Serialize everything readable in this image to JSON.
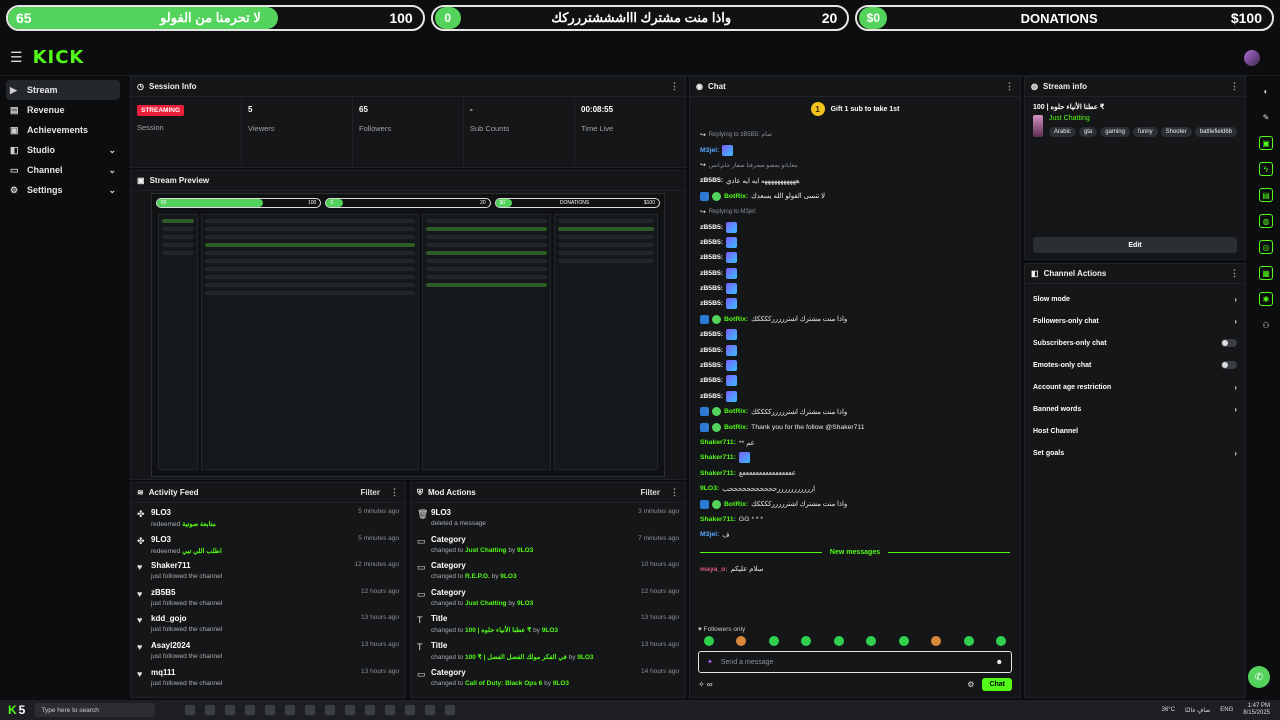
{
  "goals": [
    {
      "left": "65",
      "mid": "لا تحرمنا من الفولو",
      "right": "100",
      "progress": 0.65
    },
    {
      "badge": "0",
      "mid": "واذا منت مشترك اااشششتررركك",
      "right": "20",
      "progress": 0.0
    },
    {
      "badge": "$0",
      "mid": "DONATIONS",
      "right": "$100",
      "progress": 0.0
    }
  ],
  "browser": {
    "url": "dashboard.kick.com/stream"
  },
  "header": {
    "logo": "KICK"
  },
  "nav": [
    {
      "label": "Stream",
      "icon": "video-icon",
      "active": true
    },
    {
      "label": "Revenue",
      "icon": "dollar-icon",
      "active": false
    },
    {
      "label": "Achievements",
      "icon": "trophy-icon",
      "active": false
    },
    {
      "label": "Studio",
      "icon": "studio-icon",
      "active": false,
      "expandable": true
    },
    {
      "label": "Channel",
      "icon": "channel-icon",
      "active": false,
      "expandable": true
    },
    {
      "label": "Settings",
      "icon": "gear-icon",
      "active": false,
      "expandable": true
    }
  ],
  "session": {
    "title": "Session Info",
    "status": "STREAMING",
    "status_label": "Session",
    "viewers": "5",
    "viewers_label": "Viewers",
    "followers": "65",
    "followers_label": "Followers",
    "subs": "-",
    "subs_label": "Sub Counts",
    "time": "00:08:55",
    "time_label": "Time Live"
  },
  "preview": {
    "title": "Stream Preview",
    "goals": [
      "65",
      "100",
      "0",
      "20",
      "$0",
      "DONATIONS",
      "$100"
    ]
  },
  "activity": {
    "title": "Activity Feed",
    "filter": "Filter",
    "items": [
      {
        "name": "9LO3",
        "sub": "redeemed",
        "hl": "متابعة صوتية",
        "time": "5 minutes ago",
        "icon": "gift-icon"
      },
      {
        "name": "9LO3",
        "sub": "redeemed",
        "hl": "اطلب اللي تبي",
        "time": "5 minutes ago",
        "icon": "gift-icon"
      },
      {
        "name": "Shaker711",
        "sub": "just followed the channel",
        "hl": "",
        "time": "12 minutes ago",
        "icon": "heart-icon"
      },
      {
        "name": "zB5B5",
        "sub": "just followed the channel",
        "hl": "",
        "time": "12 hours ago",
        "icon": "heart-icon"
      },
      {
        "name": "kdd_gojo",
        "sub": "just followed the channel",
        "hl": "",
        "time": "13 hours ago",
        "icon": "heart-icon"
      },
      {
        "name": "Asayl2024",
        "sub": "just followed the channel",
        "hl": "",
        "time": "13 hours ago",
        "icon": "heart-icon"
      },
      {
        "name": "mq111",
        "sub": "just followed the channel",
        "hl": "",
        "time": "13 hours ago",
        "icon": "heart-icon"
      }
    ]
  },
  "mod": {
    "title": "Mod Actions",
    "filter": "Filter",
    "items": [
      {
        "name": "9LO3",
        "pre": "deleted a message",
        "hl": "",
        "by": "",
        "by_user": "",
        "time": "3 minutes ago",
        "icon": "trash-icon"
      },
      {
        "name": "Category",
        "pre": "changed to",
        "hl": "Just Chatting",
        "by": "by",
        "by_user": "9LO3",
        "time": "7 minutes ago",
        "icon": "category-icon"
      },
      {
        "name": "Category",
        "pre": "changed to",
        "hl": "R.E.P.O.",
        "by": "by",
        "by_user": "9LO3",
        "time": "10 hours ago",
        "icon": "category-icon"
      },
      {
        "name": "Category",
        "pre": "changed to",
        "hl": "Just Chatting",
        "by": "by",
        "by_user": "9LO3",
        "time": "12 hours ago",
        "icon": "category-icon"
      },
      {
        "name": "Title",
        "pre": "changed to",
        "hl": "عطنا الأنياء حلوه | 100 ₹",
        "by": "by",
        "by_user": "9LO3",
        "time": "13 hours ago",
        "icon": "text-icon"
      },
      {
        "name": "Title",
        "pre": "changed to",
        "hl": "100 ₹ | في الفكر مولك الفصل الفصل",
        "by": "by",
        "by_user": "9LO3",
        "time": "13 hours ago",
        "icon": "text-icon"
      },
      {
        "name": "Category",
        "pre": "changed to",
        "hl": "Call of Duty: Black Ops 6",
        "by": "by",
        "by_user": "9LO3",
        "time": "14 hours ago",
        "icon": "category-icon"
      }
    ]
  },
  "chat": {
    "title": "Chat",
    "gift": "Gift 1 sub to take 1st",
    "gift_count": "1",
    "messages": [
      {
        "reply": "Replying to zB5B5: تمام",
        "user": "",
        "text": "",
        "color": "#8d9195"
      },
      {
        "reply": "",
        "user": "M3jel:",
        "text": "",
        "color": "#59a9ff",
        "emote": true
      },
      {
        "reply": "معاياتو يمضو مصرفنا صفار جايرانس",
        "user": "",
        "text": "",
        "color": "#8d9195"
      },
      {
        "reply": "",
        "user": "zB5B5:",
        "text": "هههههههههههه ايه ايه عادي",
        "color": "#fff"
      },
      {
        "reply": "",
        "user": "BotRix:",
        "text": "لا تنسى الفولو الله يسعدك",
        "color": "#53fc18",
        "bot": true
      },
      {
        "reply": "Replying to M3jel:",
        "user": "",
        "text": "",
        "color": "#8d9195"
      },
      {
        "reply": "",
        "user": "zB5B5:",
        "text": "",
        "color": "#fff",
        "emote": true
      },
      {
        "reply": "",
        "user": "zB5B5:",
        "text": "",
        "color": "#fff",
        "emote": true
      },
      {
        "reply": "",
        "user": "zB5B5:",
        "text": "",
        "color": "#fff",
        "emote": true
      },
      {
        "reply": "",
        "user": "zB5B5:",
        "text": "",
        "color": "#fff",
        "emote": true
      },
      {
        "reply": "",
        "user": "zB5B5:",
        "text": "",
        "color": "#fff",
        "emote": true
      },
      {
        "reply": "",
        "user": "zB5B5:",
        "text": "",
        "color": "#fff",
        "emote": true
      },
      {
        "reply": "",
        "user": "BotRix:",
        "text": "واذا منت مشترك اشترررررككككك",
        "color": "#53fc18",
        "bot": true
      },
      {
        "reply": "",
        "user": "zB5B5:",
        "text": "",
        "color": "#fff",
        "emote": true
      },
      {
        "reply": "",
        "user": "zB5B5:",
        "text": "",
        "color": "#fff",
        "emote": true
      },
      {
        "reply": "",
        "user": "zB5B5:",
        "text": "",
        "color": "#fff",
        "emote": true
      },
      {
        "reply": "",
        "user": "zB5B5:",
        "text": "",
        "color": "#fff",
        "emote": true
      },
      {
        "reply": "",
        "user": "zB5B5:",
        "text": "",
        "color": "#fff",
        "emote": true
      },
      {
        "reply": "",
        "user": "BotRix:",
        "text": "واذا منت مشترك اشترررررككككك",
        "color": "#53fc18",
        "bot": true
      },
      {
        "reply": "",
        "user": "BotRix:",
        "text": "Thank you for the follow @Shaker711",
        "color": "#53fc18",
        "bot": true
      },
      {
        "reply": "",
        "user": "Shaker711:",
        "text": "** عم",
        "color": "#53fc18"
      },
      {
        "reply": "",
        "user": "Shaker711:",
        "text": "",
        "color": "#53fc18",
        "emote": true
      },
      {
        "reply": "",
        "user": "Shaker711:",
        "text": "ععععععععععععععععع",
        "color": "#53fc18"
      },
      {
        "reply": "",
        "user": "9LO3:",
        "text": "ارررررررررررحححححححححححب",
        "color": "#53fc18"
      },
      {
        "reply": "",
        "user": "BotRix:",
        "text": "واذا منت مشترك اشترررررككككك",
        "color": "#53fc18",
        "bot": true
      },
      {
        "reply": "",
        "user": "Shaker711:",
        "text": "GG * * *",
        "color": "#53fc18"
      },
      {
        "reply": "",
        "user": "M3jel:",
        "text": "ف",
        "color": "#59a9ff"
      }
    ],
    "new_messages": "New messages",
    "last": {
      "user": "maya_o:",
      "text": "سلام عليكم"
    },
    "followers_only": "Followers only",
    "placeholder": "Send a message",
    "send": "Chat"
  },
  "stream_info": {
    "title": "Stream info",
    "stream_title": "عطنا الأنياء حلوه | 100 ₹",
    "category": "Just Chatting",
    "tags": [
      "Arabic",
      "gta",
      "gaming",
      "funny",
      "Shooter",
      "battlefield6b"
    ],
    "edit": "Edit"
  },
  "channel_actions": {
    "title": "Channel Actions",
    "items": [
      {
        "label": "Slow mode",
        "kind": "chev"
      },
      {
        "label": "Followers-only chat",
        "kind": "chev"
      },
      {
        "label": "Subscribers-only chat",
        "kind": "toggle"
      },
      {
        "label": "Emotes-only chat",
        "kind": "toggle"
      },
      {
        "label": "Account age restriction",
        "kind": "chev"
      },
      {
        "label": "Banned words",
        "kind": "chev"
      },
      {
        "label": "Host Channel",
        "kind": "none"
      },
      {
        "label": "Set goals",
        "kind": "chev"
      }
    ]
  },
  "taskbar": {
    "k": "K",
    "count": "5",
    "search": "Type here to search",
    "temp": "36°C",
    "weather": "صافٍ غالبًا",
    "lang": "ENG",
    "time": "1:47 PM",
    "date": "8/15/2025"
  }
}
